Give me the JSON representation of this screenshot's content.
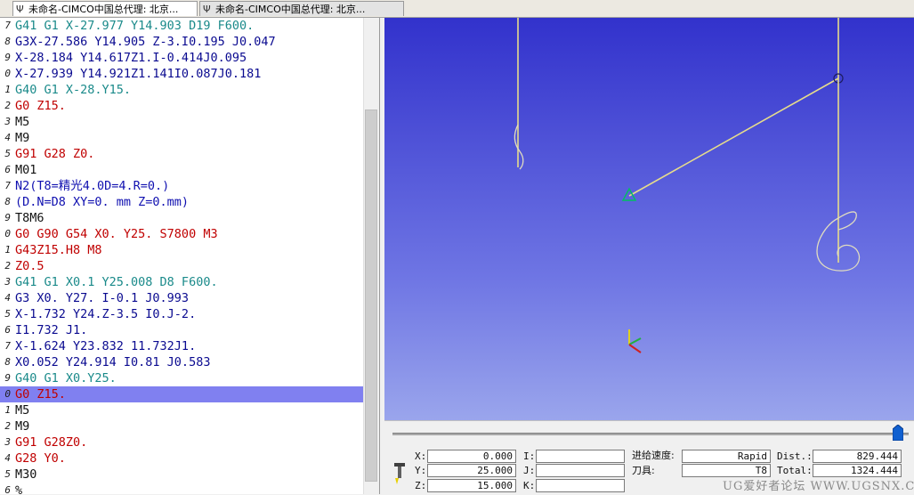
{
  "tabs": [
    {
      "label": "未命名-CIMCO中国总代理: 北京..."
    },
    {
      "label": "未命名-CIMCO中国总代理: 北京..."
    }
  ],
  "editor": {
    "lines": [
      {
        "num": "7",
        "text": "G41 G1 X-27.977 Y14.903 D19 F600.",
        "color": "#1a8a8a"
      },
      {
        "num": "8",
        "text": "G3X-27.586 Y14.905 Z-3.I0.195 J0.047",
        "color": "#0a0a90"
      },
      {
        "num": "9",
        "text": "X-28.184 Y14.617Z1.I-0.414J0.095",
        "color": "#0a0a90"
      },
      {
        "num": "0",
        "text": "X-27.939 Y14.921Z1.141I0.087J0.181",
        "color": "#0a0a90"
      },
      {
        "num": "1",
        "text": "G40 G1 X-28.Y15.",
        "color": "#1a8a8a"
      },
      {
        "num": "2",
        "text": "G0 Z15.",
        "color": "#c00000"
      },
      {
        "num": "3",
        "text": "M5",
        "color": "#101010"
      },
      {
        "num": "4",
        "text": "M9",
        "color": "#101010"
      },
      {
        "num": "5",
        "text": "G91 G28 Z0.",
        "color": "#c00000"
      },
      {
        "num": "6",
        "text": "M01",
        "color": "#101010"
      },
      {
        "num": "7",
        "text": "N2(T8=精光4.0D=4.R=0.)",
        "color": "#1010b0"
      },
      {
        "num": "8",
        "text": "(D.N=D8 XY=0. mm Z=0.mm)",
        "color": "#1010b0"
      },
      {
        "num": "9",
        "text": "T8M6",
        "color": "#101010"
      },
      {
        "num": "0",
        "text": "G0 G90 G54 X0. Y25. S7800 M3",
        "color": "#c00000"
      },
      {
        "num": "1",
        "text": "G43Z15.H8 M8",
        "color": "#c00000"
      },
      {
        "num": "2",
        "text": "Z0.5",
        "color": "#c00000"
      },
      {
        "num": "3",
        "text": "G41 G1 X0.1 Y25.008 D8 F600.",
        "color": "#1a8a8a"
      },
      {
        "num": "4",
        "text": "G3 X0. Y27. I-0.1 J0.993",
        "color": "#0a0a90"
      },
      {
        "num": "5",
        "text": "X-1.732 Y24.Z-3.5 I0.J-2.",
        "color": "#0a0a90"
      },
      {
        "num": "6",
        "text": "I1.732 J1.",
        "color": "#0a0a90"
      },
      {
        "num": "7",
        "text": "X-1.624 Y23.832 11.732J1.",
        "color": "#0a0a90"
      },
      {
        "num": "8",
        "text": "X0.052 Y24.914 I0.81 J0.583",
        "color": "#0a0a90"
      },
      {
        "num": "9",
        "text": "G40 G1 X0.Y25.",
        "color": "#1a8a8a"
      },
      {
        "num": "0",
        "text": "G0 Z15.",
        "color": "#c00000"
      },
      {
        "num": "1",
        "text": "M5",
        "color": "#101010"
      },
      {
        "num": "2",
        "text": "M9",
        "color": "#101010"
      },
      {
        "num": "3",
        "text": "G91 G28Z0.",
        "color": "#c00000"
      },
      {
        "num": "4",
        "text": "G28 Y0.",
        "color": "#c00000"
      },
      {
        "num": "5",
        "text": "M30",
        "color": "#101010"
      },
      {
        "num": "6",
        "text": "%",
        "color": "#101010"
      }
    ],
    "highlight_line": 23
  },
  "status": {
    "x_label": "X:",
    "x_value": "0.000",
    "y_label": "Y:",
    "y_value": "25.000",
    "z_label": "Z:",
    "z_value": "15.000",
    "i_label": "I:",
    "i_value": "",
    "j_label": "J:",
    "j_value": "",
    "k_label": "K:",
    "k_value": "",
    "feed_label": "进给速度:",
    "feed_value": "Rapid",
    "tool_label": "刀具:",
    "tool_value": "T8",
    "dist_label": "Dist.:",
    "dist_value": "829.444",
    "total_label": "Total:",
    "total_value": "1324.444"
  },
  "playback": {
    "progress": 0.98
  },
  "watermark": "UG爱好者论坛 WWW.UGSNX.COM",
  "colors": {
    "toolpath": "#e6dc8c",
    "highlight": "#8080f0"
  }
}
